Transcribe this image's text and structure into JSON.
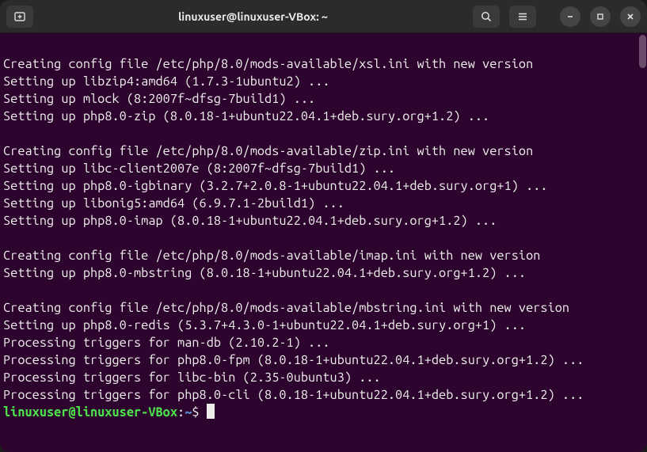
{
  "window": {
    "title": "linuxuser@linuxuser-VBox: ~"
  },
  "terminal": {
    "lines": [
      "",
      "Creating config file /etc/php/8.0/mods-available/xsl.ini with new version",
      "Setting up libzip4:amd64 (1.7.3-1ubuntu2) ...",
      "Setting up mlock (8:2007f~dfsg-7build1) ...",
      "Setting up php8.0-zip (8.0.18-1+ubuntu22.04.1+deb.sury.org+1.2) ...",
      "",
      "Creating config file /etc/php/8.0/mods-available/zip.ini with new version",
      "Setting up libc-client2007e (8:2007f~dfsg-7build1) ...",
      "Setting up php8.0-igbinary (3.2.7+2.0.8-1+ubuntu22.04.1+deb.sury.org+1) ...",
      "Setting up libonig5:amd64 (6.9.7.1-2build1) ...",
      "Setting up php8.0-imap (8.0.18-1+ubuntu22.04.1+deb.sury.org+1.2) ...",
      "",
      "Creating config file /etc/php/8.0/mods-available/imap.ini with new version",
      "Setting up php8.0-mbstring (8.0.18-1+ubuntu22.04.1+deb.sury.org+1.2) ...",
      "",
      "Creating config file /etc/php/8.0/mods-available/mbstring.ini with new version",
      "Setting up php8.0-redis (5.3.7+4.3.0-1+ubuntu22.04.1+deb.sury.org+1) ...",
      "Processing triggers for man-db (2.10.2-1) ...",
      "Processing triggers for php8.0-fpm (8.0.18-1+ubuntu22.04.1+deb.sury.org+1.2) ...",
      "Processing triggers for libc-bin (2.35-0ubuntu3) ...",
      "Processing triggers for php8.0-cli (8.0.18-1+ubuntu22.04.1+deb.sury.org+1.2) ..."
    ],
    "prompt": {
      "userhost": "linuxuser@linuxuser-VBox",
      "colon": ":",
      "path": "~",
      "dollar": "$"
    }
  }
}
